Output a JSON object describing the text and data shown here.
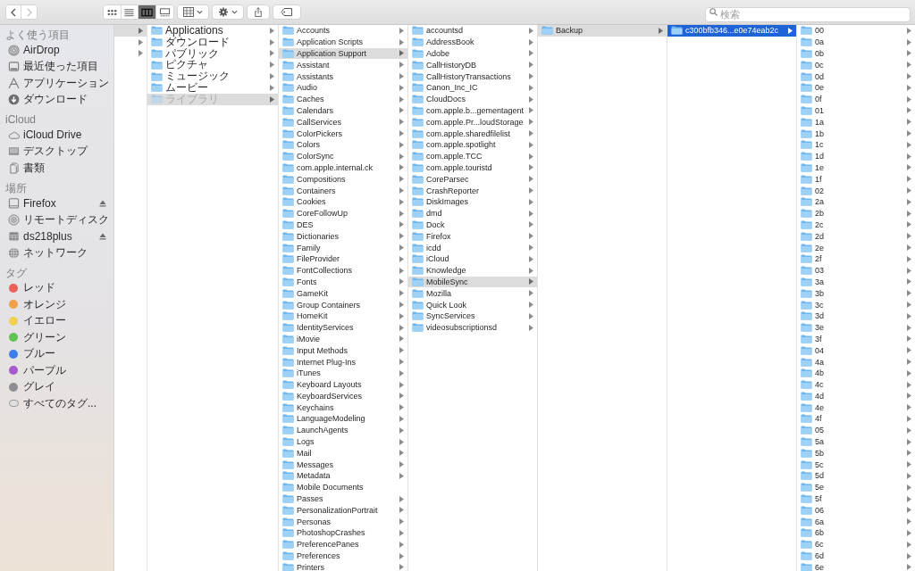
{
  "toolbar": {
    "back": {
      "disabled": false
    },
    "forward": {
      "disabled": true
    },
    "view_modes": [
      {
        "selected": false
      },
      {
        "selected": false
      },
      {
        "selected": true
      },
      {
        "selected": false
      }
    ],
    "search": {
      "placeholder": "検索"
    }
  },
  "sidebar": {
    "sections": [
      {
        "title": "よく使う項目",
        "items": [
          {
            "kind": "location",
            "label": "AirDrop"
          },
          {
            "kind": "location",
            "label": "最近使った項目"
          },
          {
            "kind": "location",
            "label": "アプリケーション"
          },
          {
            "kind": "location",
            "label": "ダウンロード"
          }
        ]
      },
      {
        "title": "iCloud",
        "items": [
          {
            "kind": "location",
            "label": "iCloud Drive"
          },
          {
            "kind": "location",
            "label": "デスクトップ"
          },
          {
            "kind": "location",
            "label": "書類"
          }
        ]
      },
      {
        "title": "場所",
        "items": [
          {
            "kind": "location",
            "label": "Firefox",
            "ejectable": true
          },
          {
            "kind": "location",
            "label": "リモートディスク",
            "ejectable": false
          },
          {
            "kind": "location",
            "label": "ds218plus",
            "ejectable": true
          },
          {
            "kind": "location",
            "label": "ネットワーク",
            "ejectable": false
          }
        ]
      },
      {
        "title": "タグ",
        "items": [
          {
            "kind": "tag",
            "label": "レッド",
            "color": "#ec5f59"
          },
          {
            "kind": "tag",
            "label": "オレンジ",
            "color": "#f0a14a"
          },
          {
            "kind": "tag",
            "label": "イエロー",
            "color": "#f4cf4f"
          },
          {
            "kind": "tag",
            "label": "グリーン",
            "color": "#62c355"
          },
          {
            "kind": "tag",
            "label": "ブルー",
            "color": "#3c7fea"
          },
          {
            "kind": "tag",
            "label": "パープル",
            "color": "#a55bcb"
          },
          {
            "kind": "tag",
            "label": "グレイ",
            "color": "#8e8e92"
          },
          {
            "kind": "all_tags",
            "label": "すべてのタグ..."
          }
        ]
      }
    ]
  },
  "columns": [
    {
      "items": [
        {
          "selected": true,
          "arrow": true
        },
        {
          "selected": false,
          "arrow": true
        },
        {
          "selected": false,
          "arrow": true
        }
      ]
    },
    {
      "items": [
        {
          "name": "Applications",
          "selected": false,
          "arrow": true,
          "dimmed": false
        },
        {
          "name": "ダウンロード",
          "selected": false,
          "arrow": true,
          "dimmed": false
        },
        {
          "name": "パブリック",
          "selected": false,
          "arrow": true,
          "dimmed": false
        },
        {
          "name": "ピクチャ",
          "selected": false,
          "arrow": true,
          "dimmed": false
        },
        {
          "name": "ミュージック",
          "selected": false,
          "arrow": true,
          "dimmed": false
        },
        {
          "name": "ムービー",
          "selected": false,
          "arrow": true,
          "dimmed": false
        },
        {
          "name": "ライブラリ",
          "selected": true,
          "arrow": true,
          "dimmed": true
        }
      ]
    },
    {
      "items": [
        {
          "name": "Accounts",
          "selected": false,
          "arrow": true
        },
        {
          "name": "Application Scripts",
          "selected": false,
          "arrow": true
        },
        {
          "name": "Application Support",
          "selected": true,
          "arrow": true
        },
        {
          "name": "Assistant",
          "selected": false,
          "arrow": true
        },
        {
          "name": "Assistants",
          "selected": false,
          "arrow": true
        },
        {
          "name": "Audio",
          "selected": false,
          "arrow": true
        },
        {
          "name": "Caches",
          "selected": false,
          "arrow": true
        },
        {
          "name": "Calendars",
          "selected": false,
          "arrow": true
        },
        {
          "name": "CallServices",
          "selected": false,
          "arrow": true
        },
        {
          "name": "ColorPickers",
          "selected": false,
          "arrow": true
        },
        {
          "name": "Colors",
          "selected": false,
          "arrow": true
        },
        {
          "name": "ColorSync",
          "selected": false,
          "arrow": true
        },
        {
          "name": "com.apple.internal.ck",
          "selected": false,
          "arrow": true
        },
        {
          "name": "Compositions",
          "selected": false,
          "arrow": true
        },
        {
          "name": "Containers",
          "selected": false,
          "arrow": true
        },
        {
          "name": "Cookies",
          "selected": false,
          "arrow": true
        },
        {
          "name": "CoreFollowUp",
          "selected": false,
          "arrow": true
        },
        {
          "name": "DES",
          "selected": false,
          "arrow": true
        },
        {
          "name": "Dictionaries",
          "selected": false,
          "arrow": true
        },
        {
          "name": "Family",
          "selected": false,
          "arrow": true
        },
        {
          "name": "FileProvider",
          "selected": false,
          "arrow": true
        },
        {
          "name": "FontCollections",
          "selected": false,
          "arrow": true
        },
        {
          "name": "Fonts",
          "selected": false,
          "arrow": true
        },
        {
          "name": "GameKit",
          "selected": false,
          "arrow": true
        },
        {
          "name": "Group Containers",
          "selected": false,
          "arrow": true
        },
        {
          "name": "HomeKit",
          "selected": false,
          "arrow": true
        },
        {
          "name": "IdentityServices",
          "selected": false,
          "arrow": true
        },
        {
          "name": "iMovie",
          "selected": false,
          "arrow": true
        },
        {
          "name": "Input Methods",
          "selected": false,
          "arrow": true
        },
        {
          "name": "Internet Plug-Ins",
          "selected": false,
          "arrow": true
        },
        {
          "name": "iTunes",
          "selected": false,
          "arrow": true
        },
        {
          "name": "Keyboard Layouts",
          "selected": false,
          "arrow": true
        },
        {
          "name": "KeyboardServices",
          "selected": false,
          "arrow": true
        },
        {
          "name": "Keychains",
          "selected": false,
          "arrow": true
        },
        {
          "name": "LanguageModeling",
          "selected": false,
          "arrow": true
        },
        {
          "name": "LaunchAgents",
          "selected": false,
          "arrow": true
        },
        {
          "name": "Logs",
          "selected": false,
          "arrow": true
        },
        {
          "name": "Mail",
          "selected": false,
          "arrow": true
        },
        {
          "name": "Messages",
          "selected": false,
          "arrow": true
        },
        {
          "name": "Metadata",
          "selected": false,
          "arrow": true
        },
        {
          "name": "Mobile Documents",
          "selected": false,
          "arrow": false
        },
        {
          "name": "Passes",
          "selected": false,
          "arrow": true
        },
        {
          "name": "PersonalizationPortrait",
          "selected": false,
          "arrow": true
        },
        {
          "name": "Personas",
          "selected": false,
          "arrow": true
        },
        {
          "name": "PhotoshopCrashes",
          "selected": false,
          "arrow": true
        },
        {
          "name": "PreferencePanes",
          "selected": false,
          "arrow": true
        },
        {
          "name": "Preferences",
          "selected": false,
          "arrow": true
        },
        {
          "name": "Printers",
          "selected": false,
          "arrow": true
        }
      ]
    },
    {
      "items": [
        {
          "name": "accountsd",
          "selected": false,
          "arrow": true
        },
        {
          "name": "AddressBook",
          "selected": false,
          "arrow": true
        },
        {
          "name": "Adobe",
          "selected": false,
          "arrow": true
        },
        {
          "name": "CallHistoryDB",
          "selected": false,
          "arrow": true
        },
        {
          "name": "CallHistoryTransactions",
          "selected": false,
          "arrow": true
        },
        {
          "name": "Canon_Inc_IC",
          "selected": false,
          "arrow": true
        },
        {
          "name": "CloudDocs",
          "selected": false,
          "arrow": true
        },
        {
          "name": "com.apple.b...gementagent",
          "selected": false,
          "arrow": true
        },
        {
          "name": "com.apple.Pr...loudStorage",
          "selected": false,
          "arrow": true
        },
        {
          "name": "com.apple.sharedfilelist",
          "selected": false,
          "arrow": true
        },
        {
          "name": "com.apple.spotlight",
          "selected": false,
          "arrow": true
        },
        {
          "name": "com.apple.TCC",
          "selected": false,
          "arrow": true
        },
        {
          "name": "com.apple.touristd",
          "selected": false,
          "arrow": true
        },
        {
          "name": "CoreParsec",
          "selected": false,
          "arrow": true
        },
        {
          "name": "CrashReporter",
          "selected": false,
          "arrow": true
        },
        {
          "name": "DiskImages",
          "selected": false,
          "arrow": true
        },
        {
          "name": "dmd",
          "selected": false,
          "arrow": true
        },
        {
          "name": "Dock",
          "selected": false,
          "arrow": true
        },
        {
          "name": "Firefox",
          "selected": false,
          "arrow": true
        },
        {
          "name": "icdd",
          "selected": false,
          "arrow": true
        },
        {
          "name": "iCloud",
          "selected": false,
          "arrow": true
        },
        {
          "name": "Knowledge",
          "selected": false,
          "arrow": true
        },
        {
          "name": "MobileSync",
          "selected": true,
          "arrow": true
        },
        {
          "name": "Mozilla",
          "selected": false,
          "arrow": true
        },
        {
          "name": "Quick Look",
          "selected": false,
          "arrow": true
        },
        {
          "name": "SyncServices",
          "selected": false,
          "arrow": true
        },
        {
          "name": "videosubscriptionsd",
          "selected": false,
          "arrow": true
        }
      ]
    },
    {
      "items": [
        {
          "name": "Backup",
          "selected": true,
          "arrow": true
        }
      ]
    },
    {
      "focused": true,
      "items": [
        {
          "name": "c300bfb346...e0e74eab2c",
          "selected": true,
          "arrow": true
        }
      ]
    },
    {
      "items": [
        {
          "name": "00",
          "selected": false,
          "arrow": true
        },
        {
          "name": "0a",
          "selected": false,
          "arrow": true
        },
        {
          "name": "0b",
          "selected": false,
          "arrow": true
        },
        {
          "name": "0c",
          "selected": false,
          "arrow": true
        },
        {
          "name": "0d",
          "selected": false,
          "arrow": true
        },
        {
          "name": "0e",
          "selected": false,
          "arrow": true
        },
        {
          "name": "0f",
          "selected": false,
          "arrow": true
        },
        {
          "name": "01",
          "selected": false,
          "arrow": true
        },
        {
          "name": "1a",
          "selected": false,
          "arrow": true
        },
        {
          "name": "1b",
          "selected": false,
          "arrow": true
        },
        {
          "name": "1c",
          "selected": false,
          "arrow": true
        },
        {
          "name": "1d",
          "selected": false,
          "arrow": true
        },
        {
          "name": "1e",
          "selected": false,
          "arrow": true
        },
        {
          "name": "1f",
          "selected": false,
          "arrow": true
        },
        {
          "name": "02",
          "selected": false,
          "arrow": true
        },
        {
          "name": "2a",
          "selected": false,
          "arrow": true
        },
        {
          "name": "2b",
          "selected": false,
          "arrow": true
        },
        {
          "name": "2c",
          "selected": false,
          "arrow": true
        },
        {
          "name": "2d",
          "selected": false,
          "arrow": true
        },
        {
          "name": "2e",
          "selected": false,
          "arrow": true
        },
        {
          "name": "2f",
          "selected": false,
          "arrow": true
        },
        {
          "name": "03",
          "selected": false,
          "arrow": true
        },
        {
          "name": "3a",
          "selected": false,
          "arrow": true
        },
        {
          "name": "3b",
          "selected": false,
          "arrow": true
        },
        {
          "name": "3c",
          "selected": false,
          "arrow": true
        },
        {
          "name": "3d",
          "selected": false,
          "arrow": true
        },
        {
          "name": "3e",
          "selected": false,
          "arrow": true
        },
        {
          "name": "3f",
          "selected": false,
          "arrow": true
        },
        {
          "name": "04",
          "selected": false,
          "arrow": true
        },
        {
          "name": "4a",
          "selected": false,
          "arrow": true
        },
        {
          "name": "4b",
          "selected": false,
          "arrow": true
        },
        {
          "name": "4c",
          "selected": false,
          "arrow": true
        },
        {
          "name": "4d",
          "selected": false,
          "arrow": true
        },
        {
          "name": "4e",
          "selected": false,
          "arrow": true
        },
        {
          "name": "4f",
          "selected": false,
          "arrow": true
        },
        {
          "name": "05",
          "selected": false,
          "arrow": true
        },
        {
          "name": "5a",
          "selected": false,
          "arrow": true
        },
        {
          "name": "5b",
          "selected": false,
          "arrow": true
        },
        {
          "name": "5c",
          "selected": false,
          "arrow": true
        },
        {
          "name": "5d",
          "selected": false,
          "arrow": true
        },
        {
          "name": "5e",
          "selected": false,
          "arrow": true
        },
        {
          "name": "5f",
          "selected": false,
          "arrow": true
        },
        {
          "name": "06",
          "selected": false,
          "arrow": true
        },
        {
          "name": "6a",
          "selected": false,
          "arrow": true
        },
        {
          "name": "6b",
          "selected": false,
          "arrow": true
        },
        {
          "name": "6c",
          "selected": false,
          "arrow": true
        },
        {
          "name": "6d",
          "selected": false,
          "arrow": true
        },
        {
          "name": "6e",
          "selected": false,
          "arrow": true
        }
      ]
    }
  ]
}
